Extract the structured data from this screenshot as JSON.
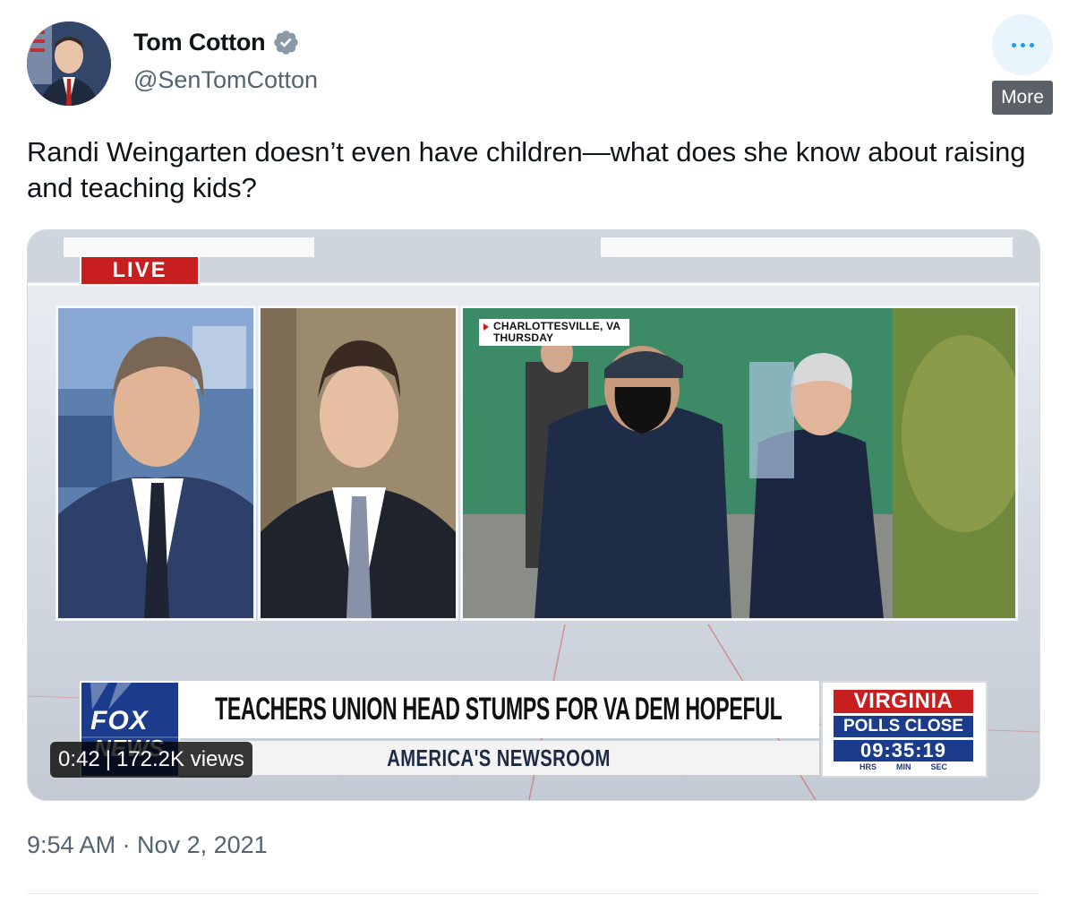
{
  "author": {
    "name": "Tom Cotton",
    "handle": "@SenTomCotton",
    "verified": true,
    "verified_color": "#8b98a5"
  },
  "more": {
    "icon": "more-horizontal-icon",
    "tooltip": "More",
    "accent": "#1d9bf0"
  },
  "tweet": {
    "text": "Randi Weingarten doesn’t even have children—what does she know about raising and teaching kids?",
    "timestamp": "9:54 AM · Nov 2, 2021"
  },
  "video": {
    "live_label": "LIVE",
    "location_line1": "CHARLOTTESVILLE, VA",
    "location_line2": "THURSDAY",
    "network_line1": "FOX",
    "network_line2": "NEWS",
    "headline": "TEACHERS UNION HEAD STUMPS FOR VA DEM HOPEFUL",
    "show_name": "AMERICA'S NEWSROOM",
    "poll_title": "VIRGINIA",
    "poll_subtitle": "POLLS CLOSE",
    "poll_countdown": "09:35:19",
    "poll_units": [
      "HRS",
      "MIN",
      "SEC"
    ],
    "elapsed": "0:42",
    "views": "172.2K views",
    "colors": {
      "live_red": "#c71f1f",
      "fox_blue": "#1b3c8c"
    }
  }
}
